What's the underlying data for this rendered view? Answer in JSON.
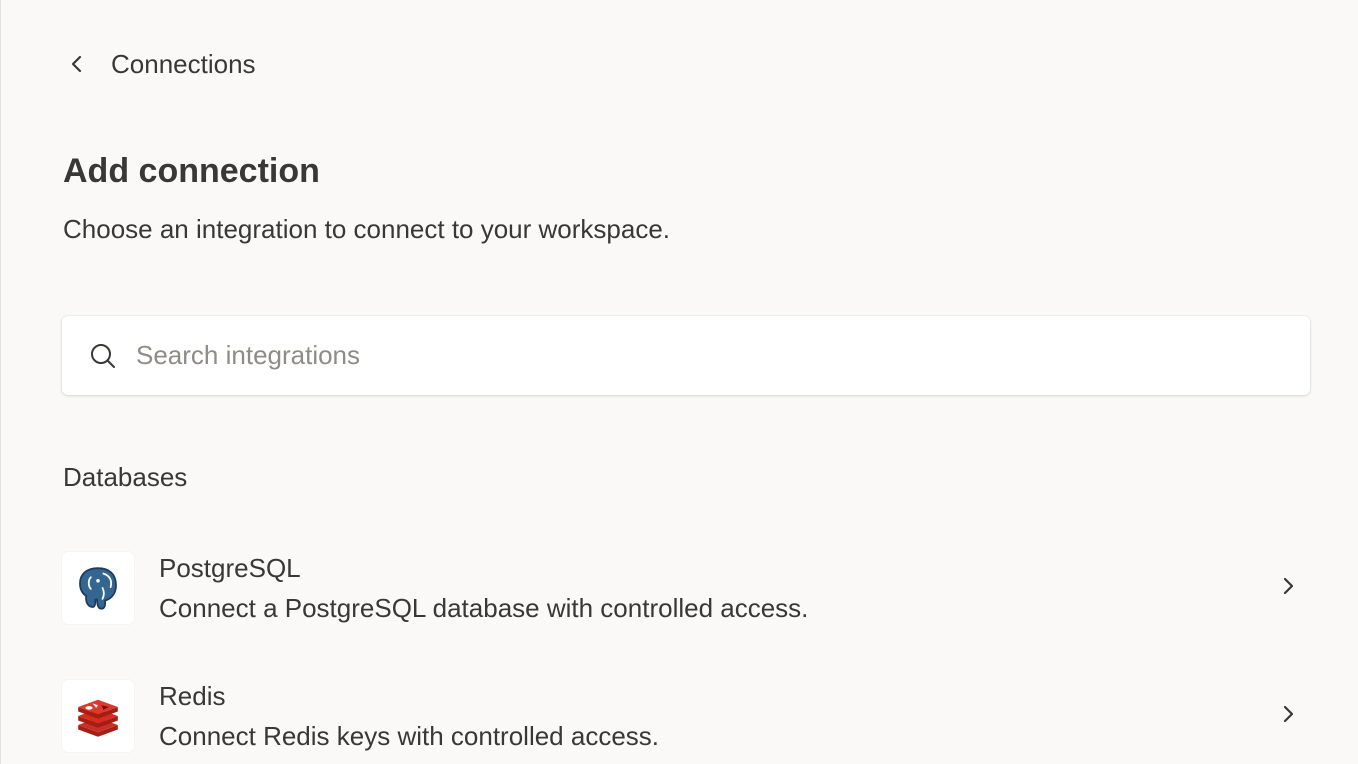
{
  "nav": {
    "back_label": "Connections"
  },
  "header": {
    "title": "Add connection",
    "subtitle": "Choose an integration to connect to your workspace."
  },
  "search": {
    "placeholder": "Search integrations",
    "value": ""
  },
  "section": {
    "title": "Databases",
    "items": [
      {
        "name": "PostgreSQL",
        "description": "Connect a PostgreSQL database with controlled access.",
        "icon": "postgresql-logo"
      },
      {
        "name": "Redis",
        "description": "Connect Redis keys with controlled access.",
        "icon": "redis-logo"
      }
    ]
  },
  "colors": {
    "background": "#faf9f7",
    "text": "#3a3835",
    "placeholder": "#8f8c87",
    "postgres_blue": "#336791",
    "redis_red": "#c6302b"
  }
}
